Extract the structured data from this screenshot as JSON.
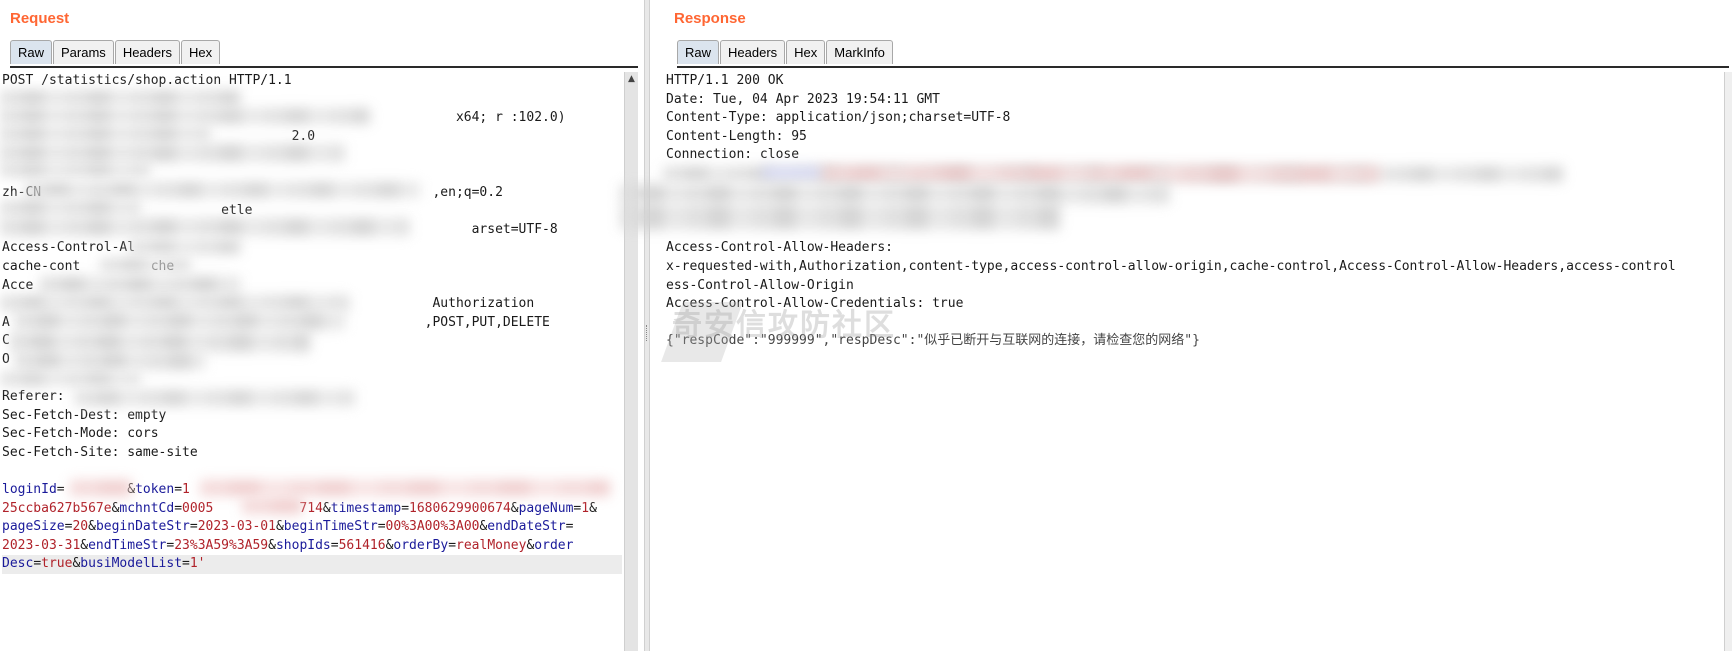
{
  "request": {
    "title": "Request",
    "tabs": [
      "Raw",
      "Params",
      "Headers",
      "Hex"
    ],
    "lines": [
      "POST /statistics/shop.action HTTP/1.1",
      "",
      "                                                          x64; r :102.0)",
      "                                     2.0",
      "",
      "",
      "zh-CN                                                  ,en;q=0.2",
      "                            etle",
      "                                                            arset=UTF-8",
      "Access-Control-Al",
      "cache-cont         che",
      "Acce",
      "                                                       Authorization",
      "A                                                     ,POST,PUT,DELETE",
      "C",
      "O",
      "",
      "Referer:",
      "Sec-Fetch-Dest: empty",
      "Sec-Fetch-Mode: cors",
      "Sec-Fetch-Site: same-site",
      ""
    ],
    "body": [
      [
        [
          "k",
          "loginId"
        ],
        [
          "p",
          "="
        ],
        [
          "v",
          "        "
        ],
        [
          "p",
          "&"
        ],
        [
          "k",
          "token"
        ],
        [
          "p",
          "="
        ],
        [
          "v",
          "1"
        ]
      ],
      [
        [
          "v",
          "25ccba627b567e"
        ],
        [
          "p",
          "&"
        ],
        [
          "k",
          "mchntCd"
        ],
        [
          "p",
          "="
        ],
        [
          "v",
          "0005           714"
        ],
        [
          "p",
          "&"
        ],
        [
          "k",
          "timestamp"
        ],
        [
          "p",
          "="
        ],
        [
          "v",
          "1680629900674"
        ],
        [
          "p",
          "&"
        ],
        [
          "k",
          "pageNum"
        ],
        [
          "p",
          "="
        ],
        [
          "v",
          "1"
        ],
        [
          "p",
          "&"
        ]
      ],
      [
        [
          "k",
          "pageSize"
        ],
        [
          "p",
          "="
        ],
        [
          "v",
          "20"
        ],
        [
          "p",
          "&"
        ],
        [
          "k",
          "beginDateStr"
        ],
        [
          "p",
          "="
        ],
        [
          "v",
          "2023-03-01"
        ],
        [
          "p",
          "&"
        ],
        [
          "k",
          "beginTimeStr"
        ],
        [
          "p",
          "="
        ],
        [
          "v",
          "00%3A00%3A00"
        ],
        [
          "p",
          "&"
        ],
        [
          "k",
          "endDateStr"
        ],
        [
          "p",
          "="
        ]
      ],
      [
        [
          "v",
          "2023-03-31"
        ],
        [
          "p",
          "&"
        ],
        [
          "k",
          "endTimeStr"
        ],
        [
          "p",
          "="
        ],
        [
          "v",
          "23%3A59%3A59"
        ],
        [
          "p",
          "&"
        ],
        [
          "k",
          "shopIds"
        ],
        [
          "p",
          "="
        ],
        [
          "v",
          "561416"
        ],
        [
          "p",
          "&"
        ],
        [
          "k",
          "orderBy"
        ],
        [
          "p",
          "="
        ],
        [
          "v",
          "realMoney"
        ],
        [
          "p",
          "&"
        ],
        [
          "k",
          "order"
        ]
      ],
      [
        [
          "k",
          "Desc"
        ],
        [
          "p",
          "="
        ],
        [
          "v",
          "true"
        ],
        [
          "p",
          "&"
        ],
        [
          "k",
          "busiModelList"
        ],
        [
          "p",
          "="
        ],
        [
          "v",
          "1'"
        ]
      ]
    ]
  },
  "response": {
    "title": "Response",
    "tabs": [
      "Raw",
      "Headers",
      "Hex",
      "MarkInfo"
    ],
    "lines": [
      "HTTP/1.1 200 OK",
      "Date: Tue, 04 Apr 2023 19:54:11 GMT",
      "Content-Type: application/json;charset=UTF-8",
      "Content-Length: 95",
      "Connection: close",
      "",
      "",
      "",
      "",
      "Access-Control-Allow-Headers:",
      "x-requested-with,Authorization,content-type,access-control-allow-origin,cache-control,Access-Control-Allow-Headers,access-control",
      "ess-Control-Allow-Origin",
      "Access-Control-Allow-Credentials: true",
      "",
      "{\"respCode\":\"999999\",\"respDesc\":\"似乎已断开与互联网的连接，请检查您的网络\"}"
    ]
  },
  "watermark": "奇安信攻防社区"
}
